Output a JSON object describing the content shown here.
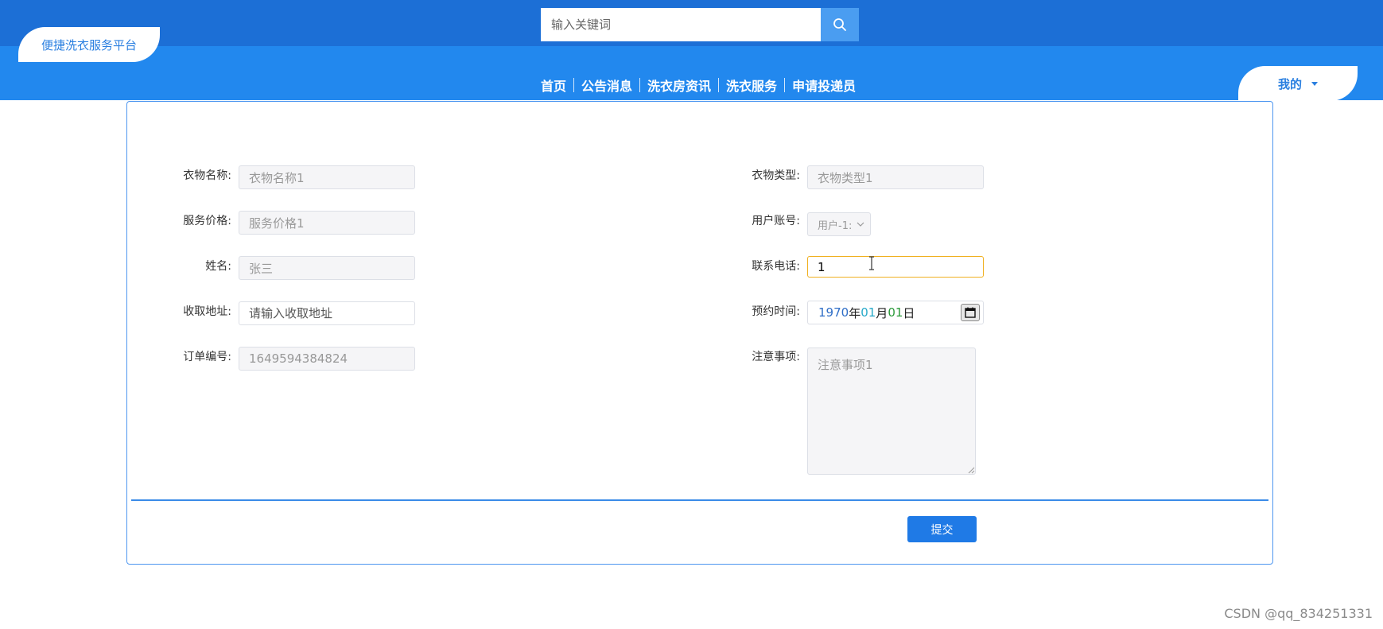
{
  "header": {
    "brand": "便捷洗衣服务平台",
    "search_placeholder": "输入关键词",
    "nav": [
      "首页",
      "公告消息",
      "洗衣房资讯",
      "洗衣服务",
      "申请投递员"
    ],
    "user_menu": "我的"
  },
  "form": {
    "labels": {
      "clothing_name": "衣物名称:",
      "service_price": "服务价格:",
      "name": "姓名:",
      "pickup_address": "收取地址:",
      "order_number": "订单编号:",
      "clothing_type": "衣物类型:",
      "user_account": "用户账号:",
      "phone": "联系电话:",
      "appointment_time": "预约时间:",
      "notes": "注意事项:"
    },
    "values": {
      "clothing_name": "衣物名称1",
      "service_price": "服务价格1",
      "name": "张三",
      "pickup_address_placeholder": "请输入收取地址",
      "order_number": "1649594384824",
      "clothing_type": "衣物类型1",
      "user_account": "用户-1:",
      "phone": "1",
      "notes": "注意事项1"
    },
    "date": {
      "year": "1970",
      "year_unit": "年",
      "month": "01",
      "month_unit": "月",
      "day": "01",
      "day_unit": "日"
    },
    "submit": "提交"
  },
  "watermark": "CSDN @qq_834251331",
  "colors": {
    "topbar": "#1c6fd6",
    "navbar": "#2288ee",
    "accent": "#1f7ae6",
    "focus_border": "#f0b020"
  }
}
